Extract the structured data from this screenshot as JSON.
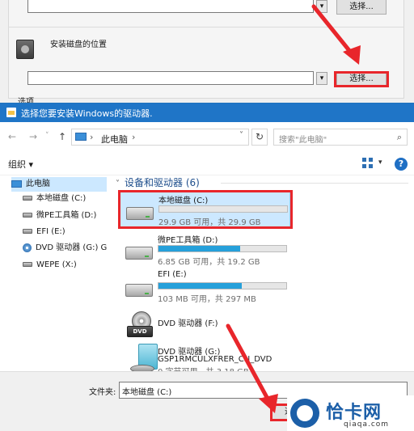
{
  "installer": {
    "select_button_top": "选择...",
    "select_button_mid": "选择...",
    "browse_glyph": "▾",
    "install_location_label": "安装磁盘的位置",
    "options_label": "选项"
  },
  "dialog": {
    "title": "选择您要安装Windows的驱动器.",
    "address": {
      "back": "←",
      "forward": "→",
      "dropdown": "˅",
      "up": "↑",
      "chevron": "›",
      "location": "此电脑",
      "trail_chevron": "›",
      "history_dropdown": "˅",
      "refresh": "↻"
    },
    "search": {
      "placeholder": "搜索\"此电脑\"",
      "icon": "search-icon"
    },
    "toolbar": {
      "organize": "组织 ▾",
      "view_dropdown": "▾",
      "help": "?"
    },
    "nav": {
      "items": [
        {
          "label": "此电脑"
        },
        {
          "label": "本地磁盘 (C:)"
        },
        {
          "label": "微PE工具箱 (D:)"
        },
        {
          "label": "EFI (E:)"
        },
        {
          "label": "DVD 驱动器 (G:) G"
        },
        {
          "label": "WEPE (X:)"
        }
      ]
    },
    "group": {
      "chevron": "˅",
      "title": "设备和驱动器 (6)"
    },
    "drives": [
      {
        "name": "本地磁盘 (C:)",
        "info": "29.9 GB 可用，共 29.9 GB",
        "used_fraction": 0.0
      },
      {
        "name": "微PE工具箱 (D:)",
        "info": "6.85 GB 可用，共 19.2 GB",
        "used_fraction": 0.64
      },
      {
        "name": "EFI (E:)",
        "info": "103 MB 可用，共 297 MB",
        "used_fraction": 0.65
      },
      {
        "name": "DVD 驱动器 (F:)"
      },
      {
        "name": "DVD 驱动器 (G:)",
        "label2": "GSP1RMCULXFRER_CN_DVD",
        "info": "0 字节可用，共 3.18 GB"
      }
    ],
    "dvd_badge": "DVD",
    "folder": {
      "label": "文件夹:",
      "value": "本地磁盘 (C:)"
    },
    "ok_label": "选"
  },
  "watermark": {
    "name": "恰卡网",
    "url": "qiaqa.com"
  },
  "colors": {
    "accent": "#1f75c7",
    "highlight_red": "#e8262b",
    "selection": "#cce8ff",
    "progress": "#26a0da"
  }
}
